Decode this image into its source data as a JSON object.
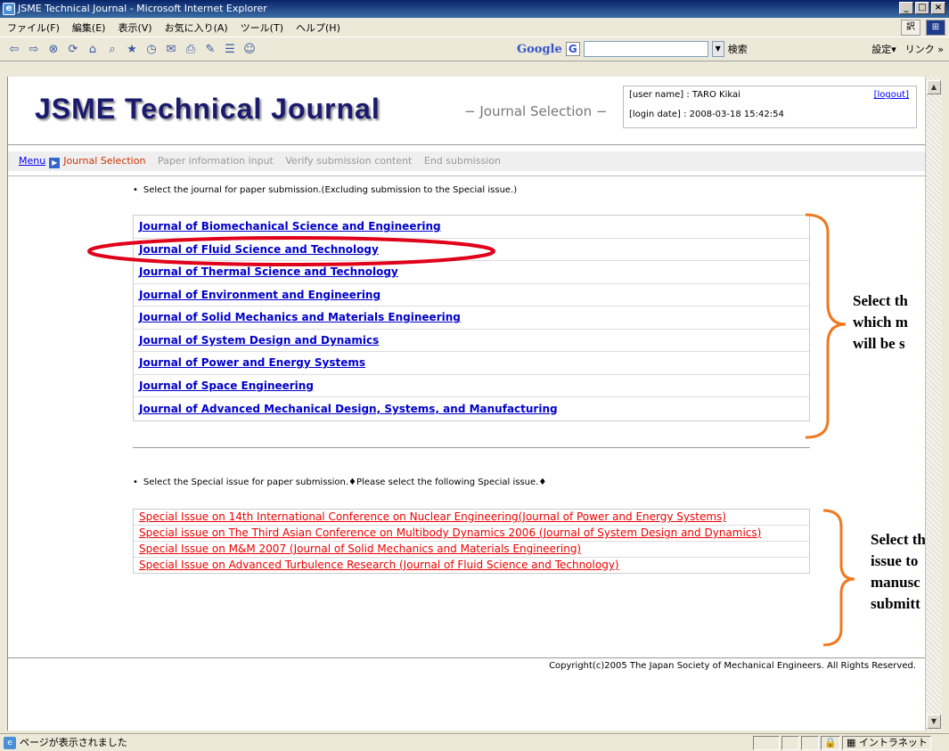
{
  "window": {
    "title": "JSME Technical Journal - Microsoft Internet Explorer"
  },
  "menubar": {
    "items": [
      "ファイル(F)",
      "編集(E)",
      "表示(V)",
      "お気に入り(A)",
      "ツール(T)",
      "ヘルプ(H)"
    ]
  },
  "toolbar": {
    "google_label": "Google",
    "search_label": "検索",
    "settings_label": "設定▾",
    "links_label": "リンク »"
  },
  "page": {
    "logo": "JSME Technical Journal",
    "subtitle": "− Journal Selection −",
    "user_line": "[user name] : TARO Kikai",
    "logout": "[logout]",
    "login_line": "[login date] : 2008-03-18 15:42:54",
    "breadcrumb": {
      "menu": "Menu",
      "active": "Journal Selection",
      "steps": [
        "Paper information input",
        "Verify submission content",
        "End submission"
      ]
    },
    "instruction_journal": "Select the journal for paper submission.(Excluding submission to the Special issue.)",
    "journals": [
      "Journal of Biomechanical Science and Engineering",
      "Journal of Fluid Science and Technology",
      "Journal of Thermal Science and Technology",
      "Journal of Environment and Engineering",
      "Journal of Solid Mechanics and Materials Engineering",
      "Journal of System Design and Dynamics",
      "Journal of Power and Energy Systems",
      "Journal of Space Engineering",
      "Journal of Advanced Mechanical Design, Systems, and Manufacturing"
    ],
    "instruction_special": "Select the Special issue for paper submission.♦Please select the following Special issue.♦",
    "special_issues": [
      "Special Issue on 14th International Conference on Nuclear Engineering(Journal of Power and Energy Systems)",
      "Special issue on The Third Asian Conference on Multibody Dynamics 2006 (Journal of System Design and Dynamics)",
      "Special Issue on M&M 2007 (Journal of Solid Mechanics and Materials Engineering)",
      "Special Issue on Advanced Turbulence Research (Journal of Fluid Science and Technology)"
    ],
    "copyright": "Copyright(c)2005 The Japan Society of Mechanical Engineers. All Rights Reserved."
  },
  "annotations": {
    "journal_note": [
      "Select th",
      "which m",
      "will be s"
    ],
    "special_note": [
      "Select th",
      "issue to",
      "manusc",
      "submitt"
    ],
    "accent_color": "#f07820",
    "highlight_color": "#e0001a"
  },
  "statusbar": {
    "text": "ページが表示されました",
    "zone": "イントラネット"
  }
}
